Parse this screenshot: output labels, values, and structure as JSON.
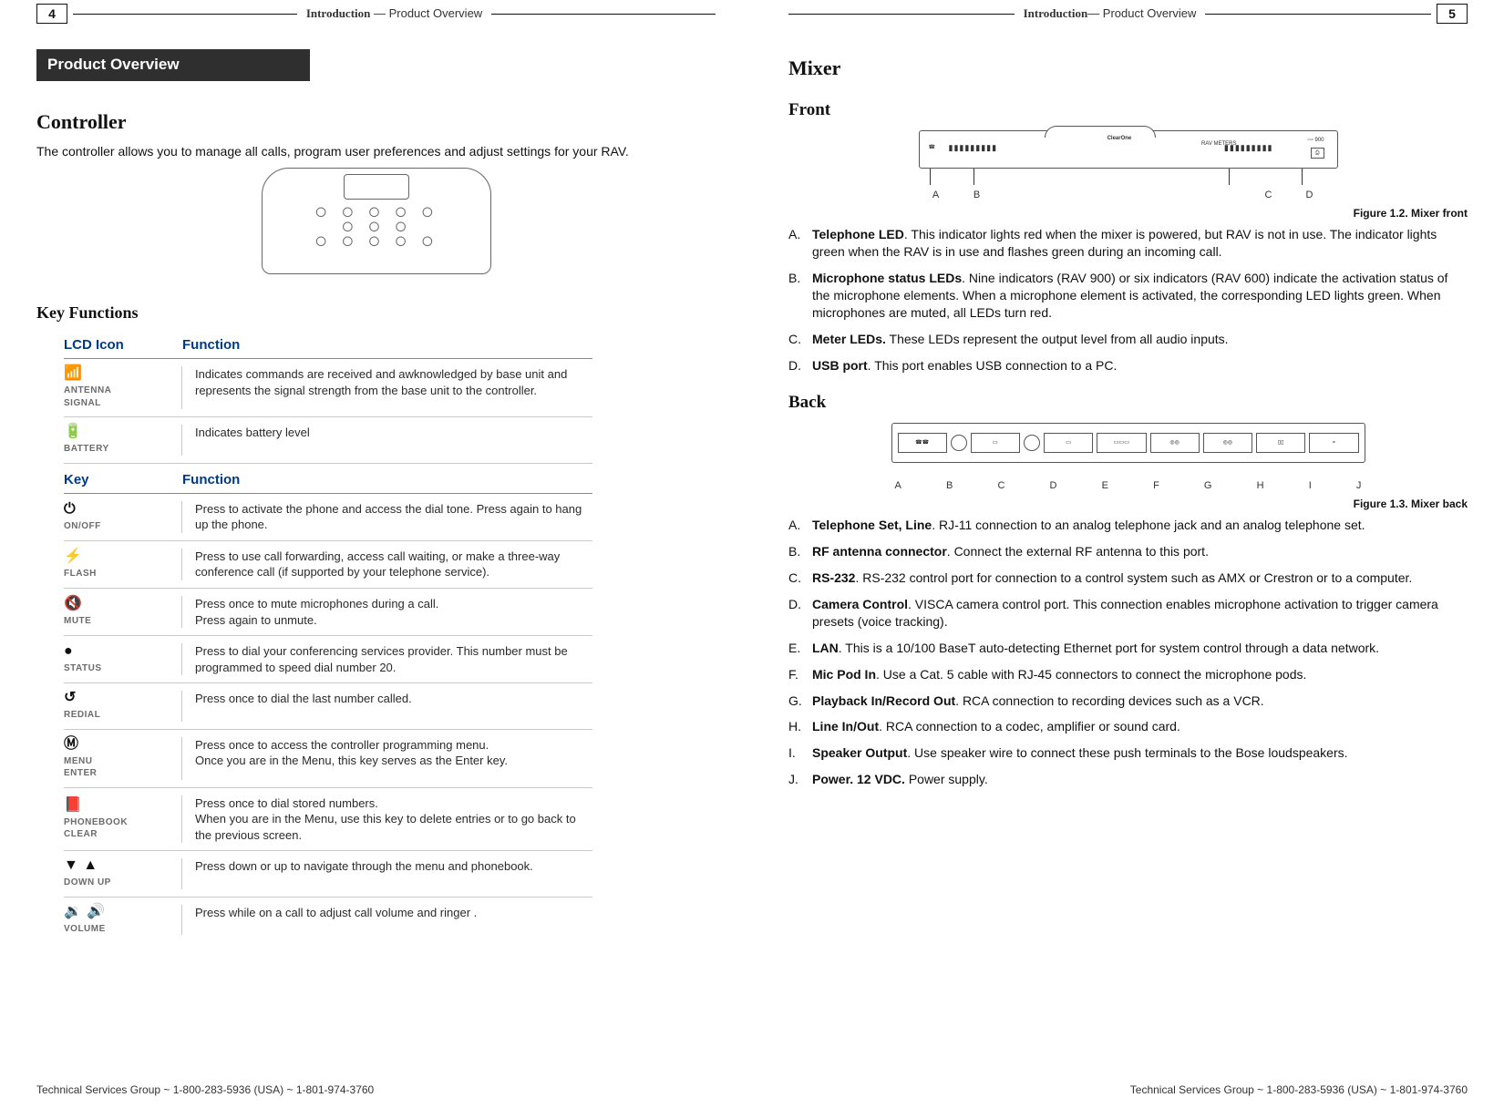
{
  "left": {
    "page_number": "4",
    "header_bold": "Introduction",
    "header_rest": " —  Product Overview",
    "section_title": "Product Overview",
    "h2": "Controller",
    "intro": "The controller allows you to manage all calls, program user preferences and adjust settings for your RAV.",
    "h4": "Key Functions",
    "col_icon": "LCD Icon",
    "col_func": "Function",
    "icons": [
      {
        "glyph": "📶",
        "label": "ANTENNA\nSIGNAL",
        "desc": "Indicates commands are received and awknowledged by base unit and represents the signal strength from the base unit to the controller."
      },
      {
        "glyph": "🔋",
        "label": "BATTERY",
        "desc": "Indicates battery level"
      }
    ],
    "col_key": "Key",
    "keys": [
      {
        "glyph": "⏻",
        "label": "ON/OFF",
        "desc": "Press to activate the phone and access the dial tone. Press again to hang up the phone."
      },
      {
        "glyph": "⚡",
        "label": "FLASH",
        "desc": "Press to use call forwarding, access call waiting, or make a three-way conference call (if supported by your telephone service)."
      },
      {
        "glyph": "🔇",
        "label": "MUTE",
        "desc": "Press once to mute microphones during a call.\nPress again to unmute."
      },
      {
        "glyph": "●",
        "label": "STATUS",
        "desc": "Press to dial your conferencing services provider. This number must be programmed to speed dial number 20."
      },
      {
        "glyph": "↺",
        "label": "REDIAL",
        "desc": "Press once to dial the last number called."
      },
      {
        "glyph": "Ⓜ",
        "label": "MENU\nENTER",
        "desc": "Press once to access the controller programming menu.\nOnce you are in the Menu, this key serves as the Enter key."
      },
      {
        "glyph": "📕",
        "label": "PHONEBOOK\nCLEAR",
        "desc": "Press once to dial stored numbers.\nWhen you are in the Menu, use this key to delete entries or to go back to the previous screen."
      },
      {
        "glyph": "▼  ▲",
        "label": "DOWN   UP",
        "desc": "Press down or up to navigate through the menu and phonebook."
      },
      {
        "glyph": "🔉  🔊",
        "label": "VOLUME",
        "desc": "Press while on a call to adjust call volume and ringer ."
      }
    ],
    "footer": "Technical Services Group ~ 1-800-283-5936 (USA) ~ 1-801-974-3760"
  },
  "right": {
    "page_number": "5",
    "header_bold": "Introduction",
    "header_rest": "—  Product Overview",
    "h2": "Mixer",
    "front_h": "Front",
    "front_letters": [
      "A",
      "B",
      "C",
      "D"
    ],
    "front_caption": "Figure 1.2. Mixer front",
    "front_items": [
      {
        "letter": "A.",
        "term": "Telephone LED",
        "text": ". This indicator lights red when the mixer is powered, but RAV is not in use. The indicator lights green when the RAV is in use and flashes green during an incoming call."
      },
      {
        "letter": "B.",
        "term": "Microphone status LEDs",
        "text": ". Nine indicators (RAV 900) or six indicators (RAV 600) indicate the activation status of the microphone elements. When a microphone element is activated, the corresponding LED lights green. When microphones are muted, all LEDs turn red."
      },
      {
        "letter": "C.",
        "term": "Meter LEDs.",
        "text": " These LEDs represent the output level from all audio inputs."
      },
      {
        "letter": "D.",
        "term": "USB port",
        "text": ". This port enables USB connection to a PC."
      }
    ],
    "back_h": "Back",
    "back_letters": [
      "A",
      "B",
      "C",
      "D",
      "E",
      "F",
      "G",
      "H",
      "I",
      "J"
    ],
    "back_caption": "Figure 1.3. Mixer back",
    "back_items": [
      {
        "letter": "A.",
        "term": "Telephone Set, Line",
        "text": ". RJ-11 connection to an analog telephone jack and an analog telephone set."
      },
      {
        "letter": "B.",
        "term": "RF antenna connector",
        "text": ". Connect the external RF antenna to this port."
      },
      {
        "letter": "C.",
        "term": "RS-232",
        "text": ". RS-232 control port for connection to a control system such as AMX or Crestron or to a computer."
      },
      {
        "letter": "D.",
        "term": "Camera Control",
        "text": ". VISCA camera control port. This connection enables microphone activation to trigger camera presets (voice tracking)."
      },
      {
        "letter": "E.",
        "term": "LAN",
        "text": ". This is a 10/100 BaseT auto-detecting Ethernet port for system control through a data network."
      },
      {
        "letter": "F.",
        "term": "Mic Pod In",
        "text": ". Use a Cat. 5 cable with RJ-45 connectors to connect the microphone pods."
      },
      {
        "letter": "G.",
        "term": "Playback In/Record Out",
        "text": ". RCA connection to recording devices such as a VCR."
      },
      {
        "letter": "H.",
        "term": "Line In/Out",
        "text": ". RCA connection to a codec, amplifier or sound card."
      },
      {
        "letter": "I.",
        "term": "Speaker Output",
        "text": ". Use speaker wire to connect these push terminals to the Bose loudspeakers."
      },
      {
        "letter": "J.",
        "term": "Power. 12 VDC.",
        "text": " Power supply."
      }
    ],
    "footer": "Technical Services Group ~ 1-800-283-5936 (USA) ~ 1-801-974-3760"
  }
}
